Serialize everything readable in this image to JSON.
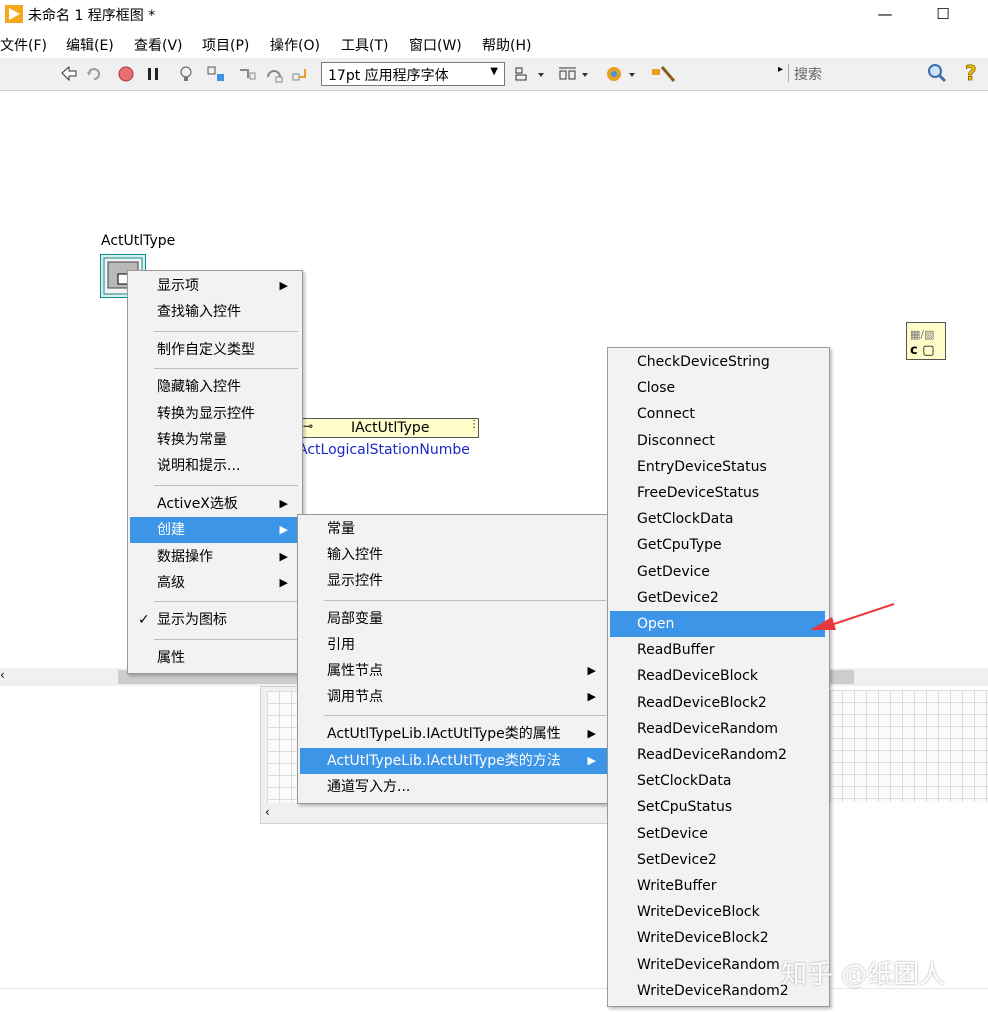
{
  "window": {
    "title": "未命名 1 程序框图 *",
    "minimize": "—",
    "maximize": "☐"
  },
  "menubar": [
    "文件(F)",
    "编辑(E)",
    "查看(V)",
    "项目(P)",
    "操作(O)",
    "工具(T)",
    "窗口(W)",
    "帮助(H)"
  ],
  "toolbar": {
    "font": "17pt 应用程序字体",
    "search_placeholder": "搜索"
  },
  "node": {
    "label": "ActUtlType"
  },
  "property_node": {
    "class": "IActUtlType",
    "property": "ActLogicalStationNumber"
  },
  "context_menu": {
    "groups": [
      [
        {
          "label": "显示项",
          "submenu": true
        },
        {
          "label": "查找输入控件"
        }
      ],
      [
        {
          "label": "制作自定义类型"
        }
      ],
      [
        {
          "label": "隐藏输入控件"
        },
        {
          "label": "转换为显示控件"
        },
        {
          "label": "转换为常量"
        },
        {
          "label": "说明和提示..."
        }
      ],
      [
        {
          "label": "ActiveX选板",
          "submenu": true
        },
        {
          "label": "创建",
          "submenu": true,
          "selected": true
        },
        {
          "label": "数据操作",
          "submenu": true
        },
        {
          "label": "高级",
          "submenu": true
        }
      ],
      [
        {
          "label": "显示为图标",
          "checked": true,
          "check": "✓"
        }
      ],
      [
        {
          "label": "属性"
        }
      ]
    ]
  },
  "create_submenu": {
    "groups": [
      [
        {
          "label": "常量"
        },
        {
          "label": "输入控件"
        },
        {
          "label": "显示控件"
        }
      ],
      [
        {
          "label": "局部变量"
        },
        {
          "label": "引用"
        },
        {
          "label": "属性节点",
          "submenu": true
        },
        {
          "label": "调用节点",
          "submenu": true
        }
      ],
      [
        {
          "label": "ActUtlTypeLib.IActUtlType类的属性",
          "submenu": true
        },
        {
          "label": "ActUtlTypeLib.IActUtlType类的方法",
          "submenu": true,
          "selected": true
        },
        {
          "label": "通道写入方..."
        }
      ]
    ]
  },
  "methods_menu": {
    "items": [
      "CheckDeviceString",
      "Close",
      "Connect",
      "Disconnect",
      "EntryDeviceStatus",
      "FreeDeviceStatus",
      "GetClockData",
      "GetCpuType",
      "GetDevice",
      "GetDevice2",
      "Open",
      "ReadBuffer",
      "ReadDeviceBlock",
      "ReadDeviceBlock2",
      "ReadDeviceRandom",
      "ReadDeviceRandom2",
      "SetClockData",
      "SetCpuStatus",
      "SetDevice",
      "SetDevice2",
      "WriteBuffer",
      "WriteDeviceBlock",
      "WriteDeviceBlock2",
      "WriteDeviceRandom",
      "WriteDeviceRandom2"
    ],
    "selected": "Open"
  },
  "watermark": "知乎 @纸团人",
  "colors": {
    "selection": "#3c95e6",
    "arrow": "#e8383d",
    "property_text": "#1c28c8"
  }
}
